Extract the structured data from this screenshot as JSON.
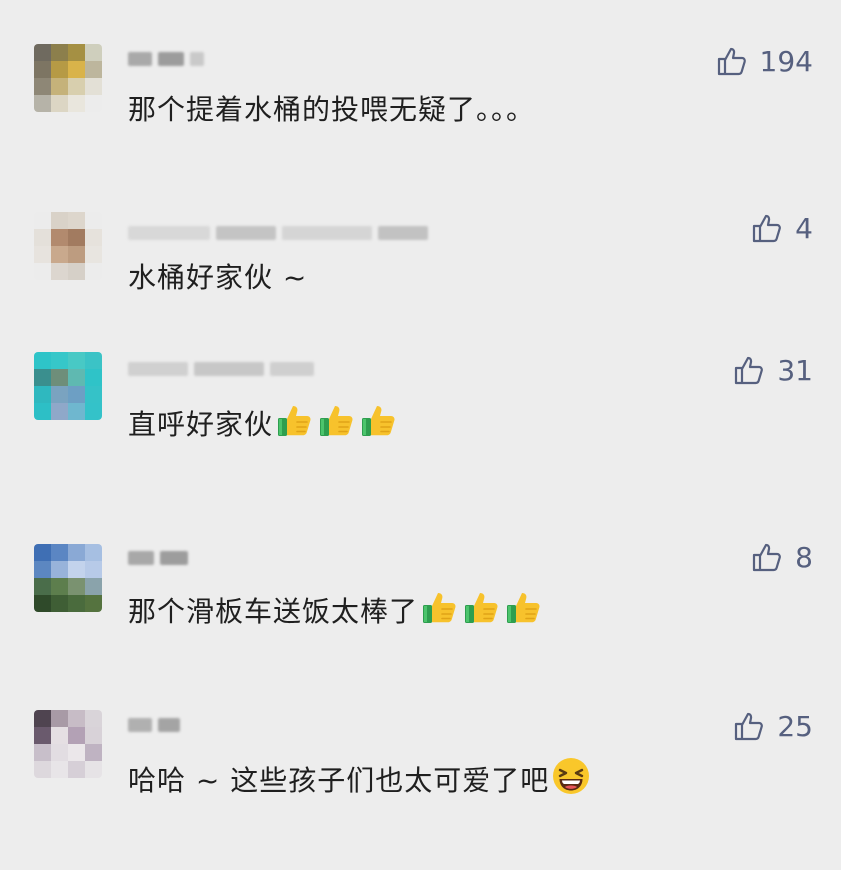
{
  "comments": [
    {
      "text": "那个提着水桶的投喂无疑了。。。",
      "likes": "194",
      "emojis": []
    },
    {
      "text": "水桶好家伙 ~",
      "likes": "4",
      "emojis": []
    },
    {
      "text": "直呼好家伙",
      "likes": "31",
      "emojis": [
        "thumbs-up-emoji",
        "thumbs-up-emoji",
        "thumbs-up-emoji"
      ]
    },
    {
      "text": "那个滑板车送饭太棒了",
      "likes": "8",
      "emojis": [
        "thumbs-up-emoji",
        "thumbs-up-emoji",
        "thumbs-up-emoji"
      ]
    },
    {
      "text": "哈哈 ~ 这些孩子们也太可爱了吧",
      "likes": "25",
      "emojis": [
        "grinning-squinting-face-emoji"
      ]
    }
  ],
  "icons": {
    "like": "thumbs-up-outline-icon"
  },
  "colors": {
    "background": "#ededed",
    "like_count": "#56607f",
    "text": "#1f1f1f"
  }
}
